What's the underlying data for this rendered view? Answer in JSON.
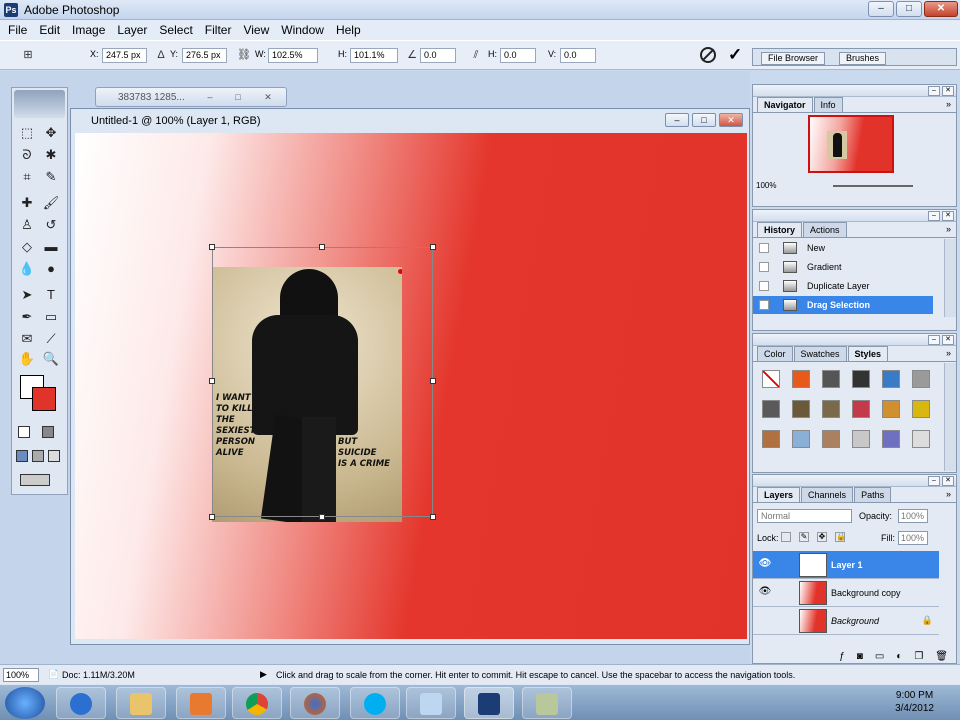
{
  "app": {
    "title": "Adobe Photoshop"
  },
  "menu": [
    "File",
    "Edit",
    "Image",
    "Layer",
    "Select",
    "Filter",
    "View",
    "Window",
    "Help"
  ],
  "options": {
    "x_label": "X:",
    "x_value": "247.5 px",
    "y_label": "Y:",
    "y_value": "276.5 px",
    "w_label": "W:",
    "w_value": "102.5%",
    "h_label": "H:",
    "h_value": "101.1%",
    "angle_value": "0.0",
    "hskew_label": "H:",
    "hskew_value": "0.0",
    "vskew_label": "V:",
    "vskew_value": "0.0",
    "file_browser": "File Browser",
    "brushes": "Brushes"
  },
  "minimized_doc": {
    "title": "383783 1285..."
  },
  "document": {
    "title": "Untitled-1 @ 100% (Layer 1, RGB)",
    "text_left": "I WANT\nTO KILL\nTHE\nSEXIEST\nPERSON\nALIVE",
    "text_right": "BUT\nSUICIDE\nIS A CRIME"
  },
  "navigator": {
    "tabs": [
      "Navigator",
      "Info"
    ],
    "zoom": "100%"
  },
  "history": {
    "tabs": [
      "History",
      "Actions"
    ],
    "items": [
      "New",
      "Gradient",
      "Duplicate Layer",
      "Drag Selection"
    ],
    "selected": "Drag Selection"
  },
  "styles": {
    "tabs": [
      "Color",
      "Swatches",
      "Styles"
    ],
    "swatch_colors": [
      "#ffffff",
      "#e85a1a",
      "#555555",
      "#333333",
      "#3a7bc8",
      "#9a9a9a",
      "#5a5a5a",
      "#6a5a3a",
      "#7a6a4a",
      "#c43a4a",
      "#d09030",
      "#d8b810",
      "#b07040",
      "#8ab0d8",
      "#aa8060",
      "#c8c8c8",
      "#7070c0",
      "#dddddd"
    ]
  },
  "layers": {
    "tabs": [
      "Layers",
      "Channels",
      "Paths"
    ],
    "blend_mode": "Normal",
    "opacity_label": "Opacity:",
    "opacity_value": "100%",
    "lock_label": "Lock:",
    "fill_label": "Fill:",
    "fill_value": "100%",
    "items": [
      "Layer 1",
      "Background copy",
      "Background"
    ]
  },
  "status": {
    "zoom": "100%",
    "doc": "Doc: 1.11M/3.20M",
    "hint": "Click and drag to scale from the corner. Hit enter to commit. Hit escape to cancel. Use the spacebar to access the navigation tools."
  },
  "taskbar": {
    "time": "9:00 PM",
    "date": "3/4/2012"
  }
}
